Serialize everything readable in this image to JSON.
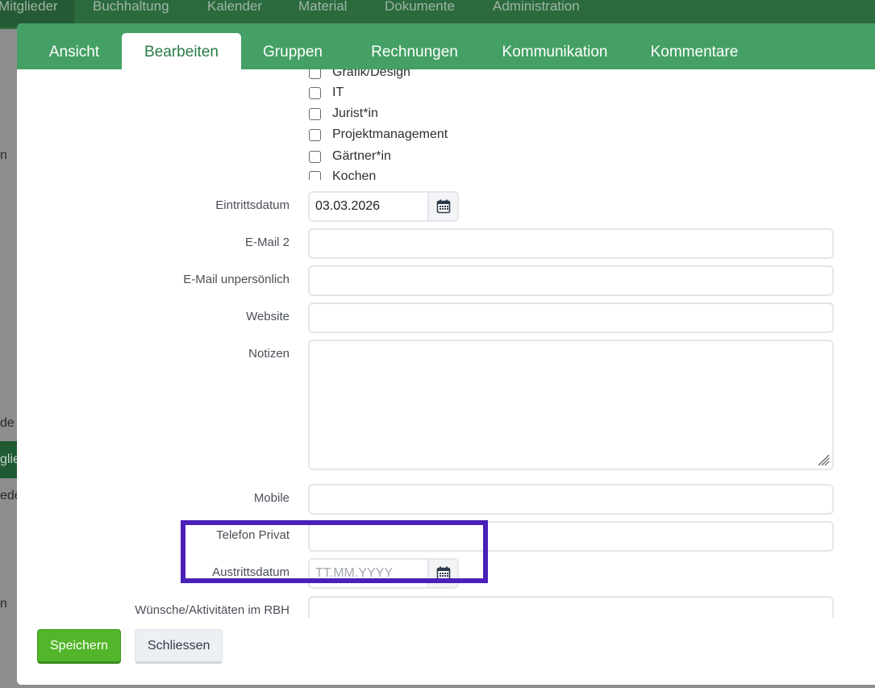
{
  "app_nav": {
    "items": [
      {
        "label": "Mitglieder"
      },
      {
        "label": "Buchhaltung"
      },
      {
        "label": "Kalender"
      },
      {
        "label": "Material"
      },
      {
        "label": "Dokumente"
      },
      {
        "label": "Administration"
      }
    ]
  },
  "background_fragments": [
    "n",
    "de",
    "glie",
    "ede",
    "n"
  ],
  "modal": {
    "tabs": [
      {
        "label": "Ansicht"
      },
      {
        "label": "Bearbeiten"
      },
      {
        "label": "Gruppen"
      },
      {
        "label": "Rechnungen"
      },
      {
        "label": "Kommunikation"
      },
      {
        "label": "Kommentare"
      }
    ],
    "active_tab": "Bearbeiten",
    "skills": [
      {
        "label": "Grafik/Design",
        "checked": false
      },
      {
        "label": "IT",
        "checked": false
      },
      {
        "label": "Jurist*in",
        "checked": false
      },
      {
        "label": "Projektmanagement",
        "checked": false
      },
      {
        "label": "Gärtner*in",
        "checked": false
      },
      {
        "label": "Kochen",
        "checked": false
      }
    ],
    "fields": {
      "eintrittsdatum": {
        "label": "Eintrittsdatum",
        "value": "03.03.2026"
      },
      "email2": {
        "label": "E-Mail 2",
        "value": ""
      },
      "email_unpersoenlich": {
        "label": "E-Mail unpersönlich",
        "value": ""
      },
      "website": {
        "label": "Website",
        "value": ""
      },
      "notizen": {
        "label": "Notizen",
        "value": ""
      },
      "mobile": {
        "label": "Mobile",
        "value": ""
      },
      "telefon_privat": {
        "label": "Telefon Privat",
        "value": ""
      },
      "austrittsdatum": {
        "label": "Austrittsdatum",
        "value": "",
        "placeholder": "TT.MM.YYYY"
      },
      "wuensche": {
        "label": "Wünsche/Aktivitäten im RBH",
        "value": ""
      }
    },
    "buttons": {
      "save": "Speichern",
      "close": "Schliessen"
    }
  },
  "colors": {
    "nav_bg": "#2b6a3d",
    "tab_bar": "#44a064",
    "active_tab_text": "#2a7d47",
    "primary_button": "#53b52a",
    "highlight_box": "#4a20b8"
  }
}
